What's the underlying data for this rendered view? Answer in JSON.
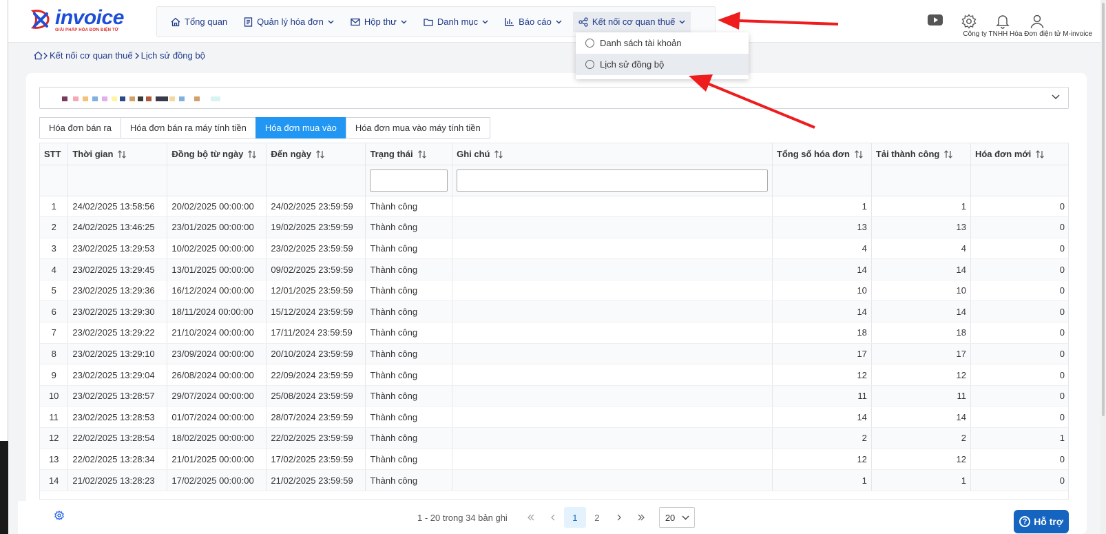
{
  "logo": {
    "brand": "invoice",
    "tagline": "GIẢI PHÁP HÓA ĐƠN ĐIỆN TỬ"
  },
  "nav": {
    "items": [
      {
        "label": "Tổng quan",
        "icon": "home-icon"
      },
      {
        "label": "Quản lý hóa đơn",
        "icon": "document-icon"
      },
      {
        "label": "Hộp thư",
        "icon": "mail-icon"
      },
      {
        "label": "Danh mục",
        "icon": "folder-icon"
      },
      {
        "label": "Báo cáo",
        "icon": "bar-chart-icon"
      },
      {
        "label": "Kết nối cơ quan thuế",
        "icon": "share-icon"
      }
    ]
  },
  "header": {
    "company": "Công ty TNHH Hóa Đơn điện tử M-invoice"
  },
  "dropdown": {
    "items": [
      "Danh sách tài khoản",
      "Lịch sử đồng bộ"
    ]
  },
  "breadcrumb": {
    "items": [
      "Kết nối cơ quan thuế",
      "Lịch sử đồng bộ"
    ]
  },
  "tabs": [
    "Hóa đơn bán ra",
    "Hóa đơn bán ra máy tính tiền",
    "Hóa đơn mua vào",
    "Hóa đơn mua vào máy tính tiền"
  ],
  "table": {
    "columns": [
      "STT",
      "Thời gian",
      "Đồng bộ từ ngày",
      "Đến ngày",
      "Trạng thái",
      "Ghi chú",
      "Tổng số hóa đơn",
      "Tải thành công",
      "Hóa đơn mới"
    ],
    "rows": [
      [
        "1",
        "24/02/2025 13:58:56",
        "20/02/2025 00:00:00",
        "24/02/2025 23:59:59",
        "Thành công",
        "",
        "1",
        "1",
        "0"
      ],
      [
        "2",
        "24/02/2025 13:46:25",
        "23/01/2025 00:00:00",
        "19/02/2025 23:59:59",
        "Thành công",
        "",
        "13",
        "13",
        "0"
      ],
      [
        "3",
        "23/02/2025 13:29:53",
        "10/02/2025 00:00:00",
        "23/02/2025 23:59:59",
        "Thành công",
        "",
        "4",
        "4",
        "0"
      ],
      [
        "4",
        "23/02/2025 13:29:45",
        "13/01/2025 00:00:00",
        "09/02/2025 23:59:59",
        "Thành công",
        "",
        "14",
        "14",
        "0"
      ],
      [
        "5",
        "23/02/2025 13:29:36",
        "16/12/2024 00:00:00",
        "12/01/2025 23:59:59",
        "Thành công",
        "",
        "10",
        "10",
        "0"
      ],
      [
        "6",
        "23/02/2025 13:29:30",
        "18/11/2024 00:00:00",
        "15/12/2024 23:59:59",
        "Thành công",
        "",
        "14",
        "14",
        "0"
      ],
      [
        "7",
        "23/02/2025 13:29:22",
        "21/10/2024 00:00:00",
        "17/11/2024 23:59:59",
        "Thành công",
        "",
        "18",
        "18",
        "0"
      ],
      [
        "8",
        "23/02/2025 13:29:10",
        "23/09/2024 00:00:00",
        "20/10/2024 23:59:59",
        "Thành công",
        "",
        "17",
        "17",
        "0"
      ],
      [
        "9",
        "23/02/2025 13:29:04",
        "26/08/2024 00:00:00",
        "22/09/2024 23:59:59",
        "Thành công",
        "",
        "12",
        "12",
        "0"
      ],
      [
        "10",
        "23/02/2025 13:28:57",
        "29/07/2024 00:00:00",
        "25/08/2024 23:59:59",
        "Thành công",
        "",
        "11",
        "11",
        "0"
      ],
      [
        "11",
        "23/02/2025 13:28:53",
        "01/07/2024 00:00:00",
        "28/07/2024 23:59:59",
        "Thành công",
        "",
        "14",
        "14",
        "0"
      ],
      [
        "12",
        "22/02/2025 13:28:54",
        "18/02/2025 00:00:00",
        "22/02/2025 23:59:59",
        "Thành công",
        "",
        "2",
        "2",
        "1"
      ],
      [
        "13",
        "22/02/2025 13:28:34",
        "21/01/2025 00:00:00",
        "17/02/2025 23:59:59",
        "Thành công",
        "",
        "12",
        "12",
        "0"
      ],
      [
        "14",
        "21/02/2025 13:28:23",
        "17/02/2025 00:00:00",
        "21/02/2025 23:59:59",
        "Thành công",
        "",
        "1",
        "1",
        "0"
      ]
    ]
  },
  "pager": {
    "info": "1 - 20 trong 34 bản ghi",
    "pages": [
      "1",
      "2"
    ],
    "page_size": "20"
  },
  "help": {
    "label": "Hỗ trợ"
  },
  "colors": {
    "brand": "#1d4ed8",
    "accent": "#2196f3",
    "arrow": "#ee1c1c"
  }
}
